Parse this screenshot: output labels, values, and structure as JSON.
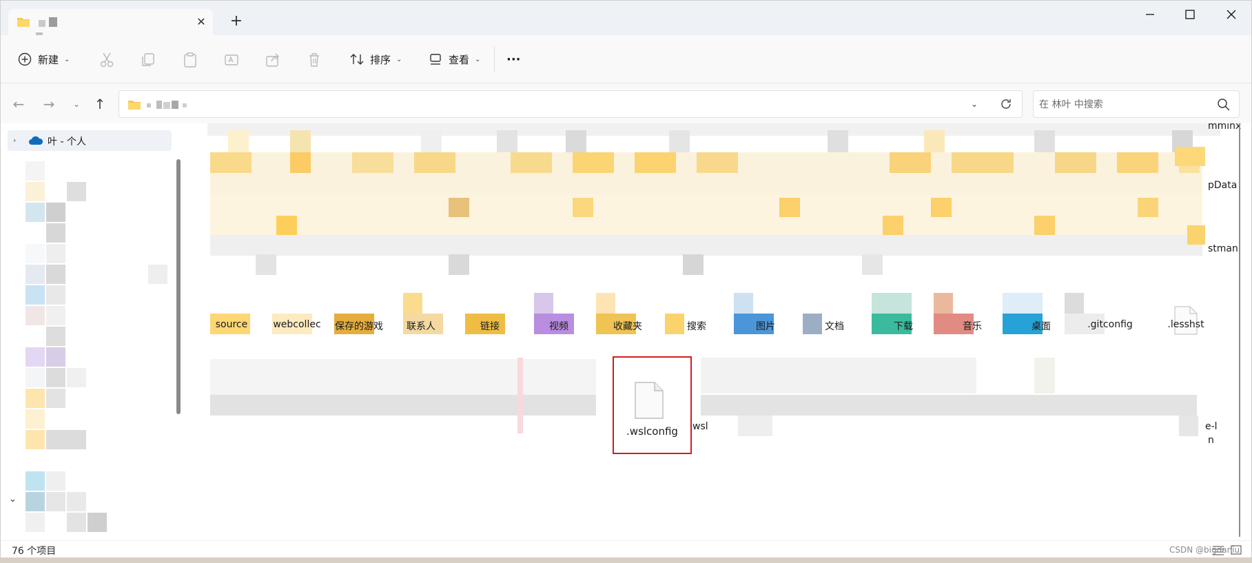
{
  "tab": {
    "title": ""
  },
  "toolbar": {
    "new_label": "新建",
    "sort_label": "排序",
    "view_label": "查看",
    "more_label": "···"
  },
  "address": {
    "path": ""
  },
  "search": {
    "placeholder": "在 林叶 中搜索"
  },
  "sidebar": {
    "onedrive_label": "叶 - 个人"
  },
  "files": {
    "row_top": [
      "mminx",
      "pData",
      "stman"
    ],
    "row_labels": [
      "source",
      "webcollec",
      "保存的游戏",
      "联系人",
      "链接",
      "视频",
      "收藏夹",
      "搜索",
      "图片",
      "文档",
      "下载",
      "音乐",
      "桌面",
      ".gitconfig",
      ".lesshst"
    ],
    "selected": ".wslconfig",
    "partial": "wsl",
    "right_partial_1": "e-l",
    "right_partial_2": "n"
  },
  "status": {
    "count": "76 个项目"
  },
  "watermark": "CSDN @bigdaniu",
  "colors": {
    "accent": "#0067c0",
    "selection_border": "#d31c1c",
    "folder": "#f7c84a"
  }
}
